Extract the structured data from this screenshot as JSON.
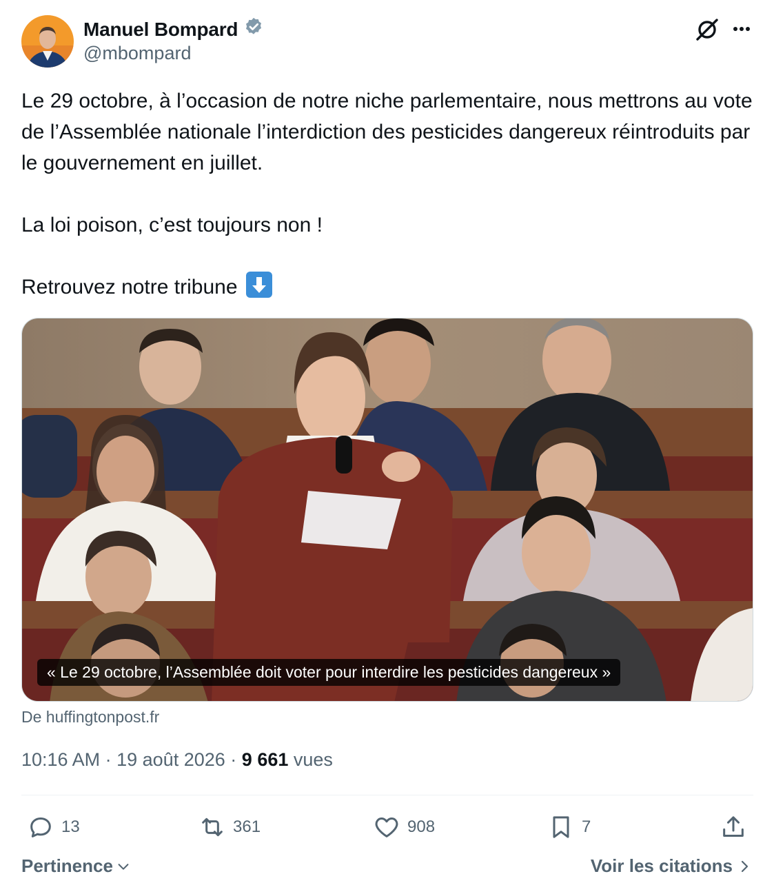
{
  "author": {
    "display_name": "Manuel Bompard",
    "handle": "@mbompard",
    "verified": true
  },
  "header_icons": [
    "grok-icon",
    "more-icon"
  ],
  "tweet": {
    "paragraph_1": "Le 29 octobre, à l’occasion de notre niche parlementaire, nous mettrons au vote de l’Assemblée nationale l’interdiction des pesticides dangereux réintroduits par le gouvernement en juillet.",
    "paragraph_2": "La loi poison, c’est toujours non !",
    "paragraph_3": "Retrouvez notre tribune",
    "emoji": "arrow-down-emoji"
  },
  "card": {
    "caption": "« Le 29 octobre, l’Assemblée doit voter pour interdire les pesticides dangereux »",
    "source": "De huffingtonpost.fr"
  },
  "meta": {
    "time": "10:16 AM",
    "separator": "·",
    "date": "19 août 2026",
    "views_count": "9 661",
    "views_label": "vues"
  },
  "actions": {
    "replies": "13",
    "reposts": "361",
    "likes": "908",
    "bookmarks": "7"
  },
  "footer": {
    "sort_label": "Pertinence",
    "quotes_label": "Voir les citations"
  },
  "colors": {
    "text_primary": "#0f1419",
    "text_secondary": "#536471",
    "verified_badge": "#829aab",
    "divider": "#eff3f4"
  }
}
